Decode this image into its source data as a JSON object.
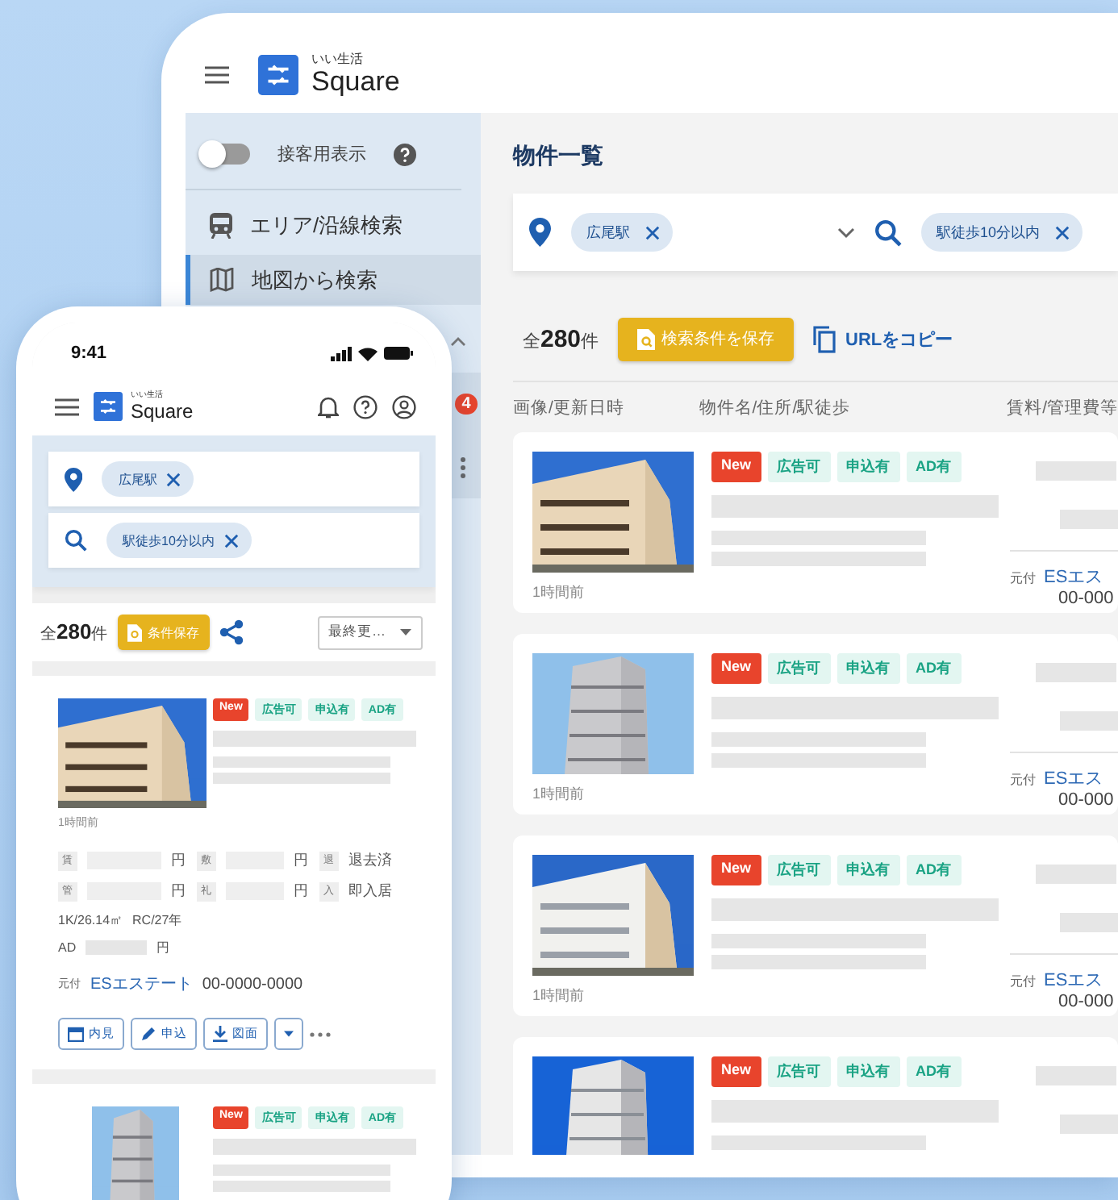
{
  "tablet": {
    "logo_caption": "いい生活",
    "logo_title": "Square",
    "sidebar": {
      "toggle": {
        "label": "接客用表示",
        "on": false
      },
      "items": [
        {
          "label": "エリア/沿線検索",
          "kind": "train",
          "selected": false
        },
        {
          "label": "地図から検索",
          "kind": "map",
          "selected": true
        }
      ],
      "badge": "4"
    },
    "page_title": "物件一覧",
    "search": {
      "location_chip": "広尾駅",
      "keyword_chip": "駅徒歩10分以内"
    },
    "count": {
      "prefix": "全",
      "number": "280",
      "suffix": "件"
    },
    "save_button": "検索条件を保存",
    "copy_link": "URLをコピー",
    "columns": [
      "画像/更新日時",
      "物件名/住所/駅徒歩",
      "賃料/管理費等"
    ],
    "rows": [
      {
        "updated": "1時間前",
        "tags": [
          {
            "label": "New",
            "kind": "new"
          },
          {
            "label": "広告可",
            "kind": "info"
          },
          {
            "label": "申込有",
            "kind": "info"
          },
          {
            "label": "AD有",
            "kind": "info"
          }
        ],
        "agent_label": "元付",
        "agent": "ESエス",
        "phone": "00-000"
      },
      {
        "updated": "1時間前",
        "tags": [
          {
            "label": "New",
            "kind": "new"
          },
          {
            "label": "広告可",
            "kind": "info"
          },
          {
            "label": "申込有",
            "kind": "info"
          },
          {
            "label": "AD有",
            "kind": "info"
          }
        ],
        "agent_label": "元付",
        "agent": "ESエス",
        "phone": "00-000"
      },
      {
        "updated": "1時間前",
        "tags": [
          {
            "label": "New",
            "kind": "new"
          },
          {
            "label": "広告可",
            "kind": "info"
          },
          {
            "label": "申込有",
            "kind": "info"
          },
          {
            "label": "AD有",
            "kind": "info"
          }
        ],
        "agent_label": "元付",
        "agent": "ESエス",
        "phone": "00-000"
      },
      {
        "tags": [
          {
            "label": "New",
            "kind": "new"
          },
          {
            "label": "広告可",
            "kind": "info"
          },
          {
            "label": "申込有",
            "kind": "info"
          },
          {
            "label": "AD有",
            "kind": "info"
          }
        ]
      }
    ]
  },
  "phone": {
    "time": "9:41",
    "logo_caption": "いい生活",
    "logo_title": "Square",
    "search": {
      "location_chip": "広尾駅",
      "keyword_chip": "駅徒歩10分以内"
    },
    "count": {
      "prefix": "全",
      "number": "280",
      "suffix": "件"
    },
    "save_button": "条件保存",
    "sort": "最終更…",
    "cards": [
      {
        "updated": "1時間前",
        "tags": [
          {
            "label": "New",
            "kind": "new"
          },
          {
            "label": "広告可",
            "kind": "info"
          },
          {
            "label": "申込有",
            "kind": "info"
          },
          {
            "label": "AD有",
            "kind": "info"
          }
        ],
        "specs": [
          [
            {
              "key": "賃",
              "unit": "円"
            },
            {
              "key": "敷",
              "unit": "円"
            },
            {
              "key": "退",
              "value": "退去済"
            }
          ],
          [
            {
              "key": "管",
              "unit": "円"
            },
            {
              "key": "礼",
              "unit": "円"
            },
            {
              "key": "入",
              "value": "即入居"
            }
          ]
        ],
        "layout": "1K/26.14㎡",
        "structure": "RC/27年",
        "ad_label": "AD",
        "ad_unit": "円",
        "agent_label": "元付",
        "agent": "ESエステート",
        "phone": "00-0000-0000",
        "actions": [
          {
            "label": "内見",
            "kind": "calendar"
          },
          {
            "label": "申込",
            "kind": "pen"
          },
          {
            "label": "図面",
            "kind": "download"
          }
        ]
      },
      {
        "tags": [
          {
            "label": "New",
            "kind": "new"
          },
          {
            "label": "広告可",
            "kind": "info"
          },
          {
            "label": "申込有",
            "kind": "info"
          },
          {
            "label": "AD有",
            "kind": "info"
          }
        ]
      }
    ]
  }
}
